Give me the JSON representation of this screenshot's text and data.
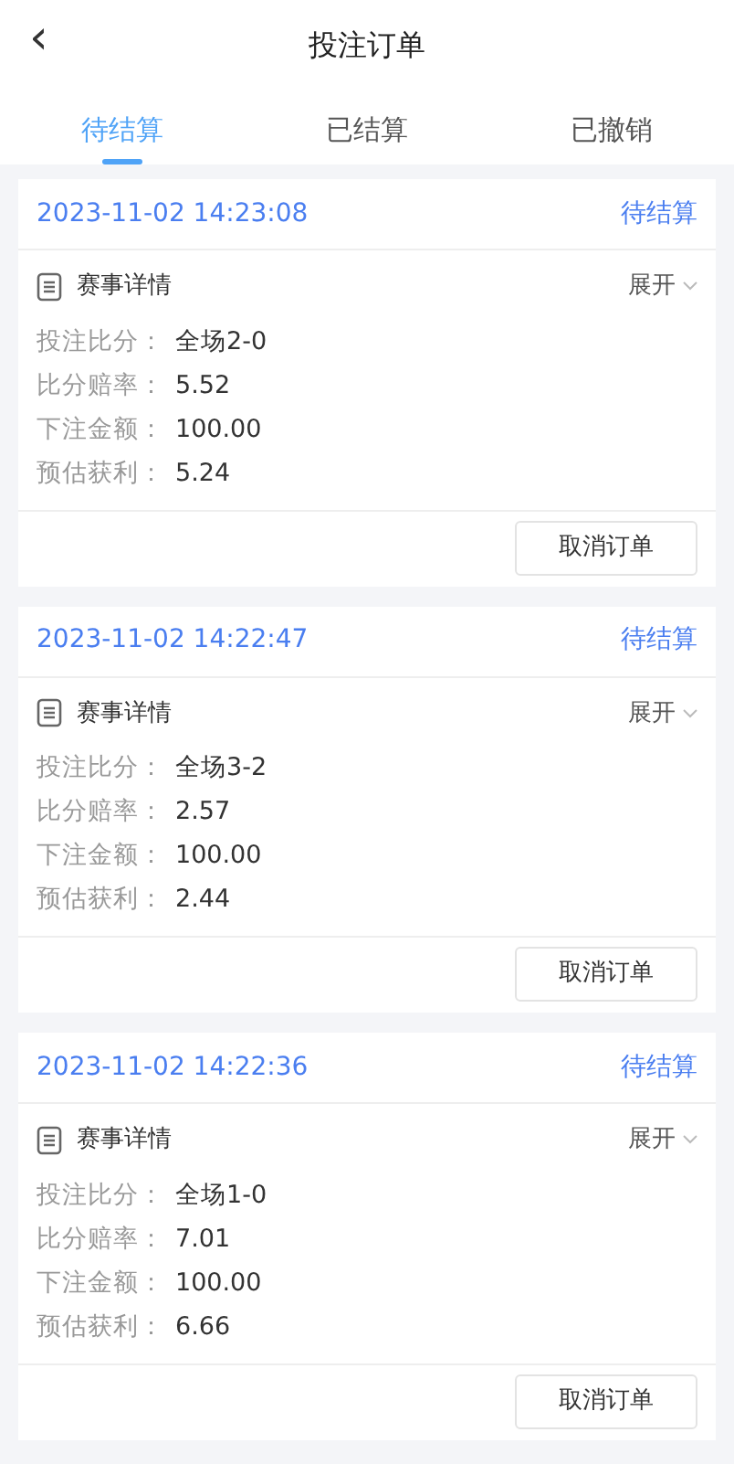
{
  "header": {
    "back": "‹",
    "title": "投注订单"
  },
  "tabs": [
    {
      "label": "待结算",
      "selected": true
    },
    {
      "label": "已结算",
      "selected": false
    },
    {
      "label": "已撤销",
      "selected": false
    }
  ],
  "orders": [
    {
      "time": "2023-11-02 14:23:08",
      "status": "待结算",
      "section": "赛事详情",
      "toggle": "展开",
      "fields": [
        {
          "label": "投注比分：",
          "value": "全场2-0"
        },
        {
          "label": "比分赔率：",
          "value": "5.52"
        },
        {
          "label": "下注金额：",
          "value": "100.00"
        },
        {
          "label": "预估获利：",
          "value": "5.24"
        }
      ],
      "action": "取消订单"
    },
    {
      "time": "2023-11-02 14:22:47",
      "status": "待结算",
      "section": "赛事详情",
      "toggle": "展开",
      "fields": [
        {
          "label": "投注比分：",
          "value": "全场3-2"
        },
        {
          "label": "比分赔率：",
          "value": "2.57"
        },
        {
          "label": "下注金额：",
          "value": "100.00"
        },
        {
          "label": "预估获利：",
          "value": "2.44"
        }
      ],
      "action": "取消订单"
    },
    {
      "time": "2023-11-02 14:22:36",
      "status": "待结算",
      "section": "赛事详情",
      "toggle": "展开",
      "fields": [
        {
          "label": "投注比分：",
          "value": "全场1-0"
        },
        {
          "label": "比分赔率：",
          "value": "7.01"
        },
        {
          "label": "下注金额：",
          "value": "100.00"
        },
        {
          "label": "预估获利：",
          "value": "6.66"
        }
      ],
      "action": "取消订单"
    }
  ]
}
